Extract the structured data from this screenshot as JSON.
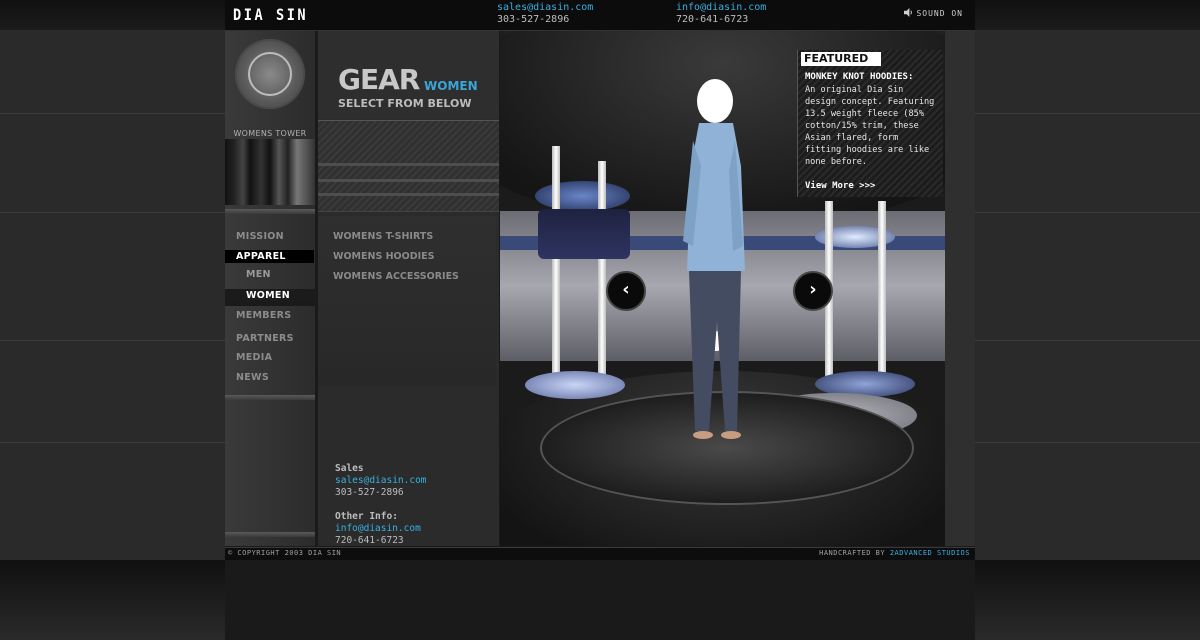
{
  "header": {
    "logo": "DIA SIN",
    "sales_email": "sales@diasin.com",
    "sales_phone": "303-527-2896",
    "info_email": "info@diasin.com",
    "info_phone": "720-641-6723",
    "sound_label": "SOUND ON"
  },
  "sidebar": {
    "tower_label": "WOMENS TOWER",
    "items": [
      {
        "label": "MISSION"
      },
      {
        "label": "APPAREL"
      },
      {
        "label": "MEN"
      },
      {
        "label": "WOMEN"
      },
      {
        "label": "MEMBERS"
      },
      {
        "label": "PARTNERS"
      },
      {
        "label": "MEDIA"
      },
      {
        "label": "NEWS"
      }
    ]
  },
  "gear": {
    "title": "GEAR",
    "category": "WOMEN",
    "subtitle": "SELECT FROM BELOW",
    "links": [
      {
        "label": "WOMENS T-SHIRTS"
      },
      {
        "label": "WOMENS HOODIES"
      },
      {
        "label": "WOMENS ACCESSORIES"
      }
    ]
  },
  "contact_block": {
    "sales_heading": "Sales",
    "sales_email": "sales@diasin.com",
    "sales_phone": "303-527-2896",
    "other_heading": "Other Info:",
    "other_email": "info@diasin.com",
    "other_phone": "720-641-6723"
  },
  "featured": {
    "tag": "FEATURED",
    "title": "MONKEY KNOT HOODIES:",
    "body": "An original Dia Sin design concept.  Featuring 13.5 weight fleece (85% cotton/15% trim, these Asian flared, form fitting hoodies are like none before.",
    "more": "View More >>>"
  },
  "stage": {
    "prev_arrow": "‹",
    "next_arrow": "›"
  },
  "footer": {
    "copyright": "© COPYRIGHT 2003 DIA SIN",
    "credit_prefix": "HANDCRAFTED BY",
    "credit_studio": "2ADVANCED STUDIOS"
  }
}
